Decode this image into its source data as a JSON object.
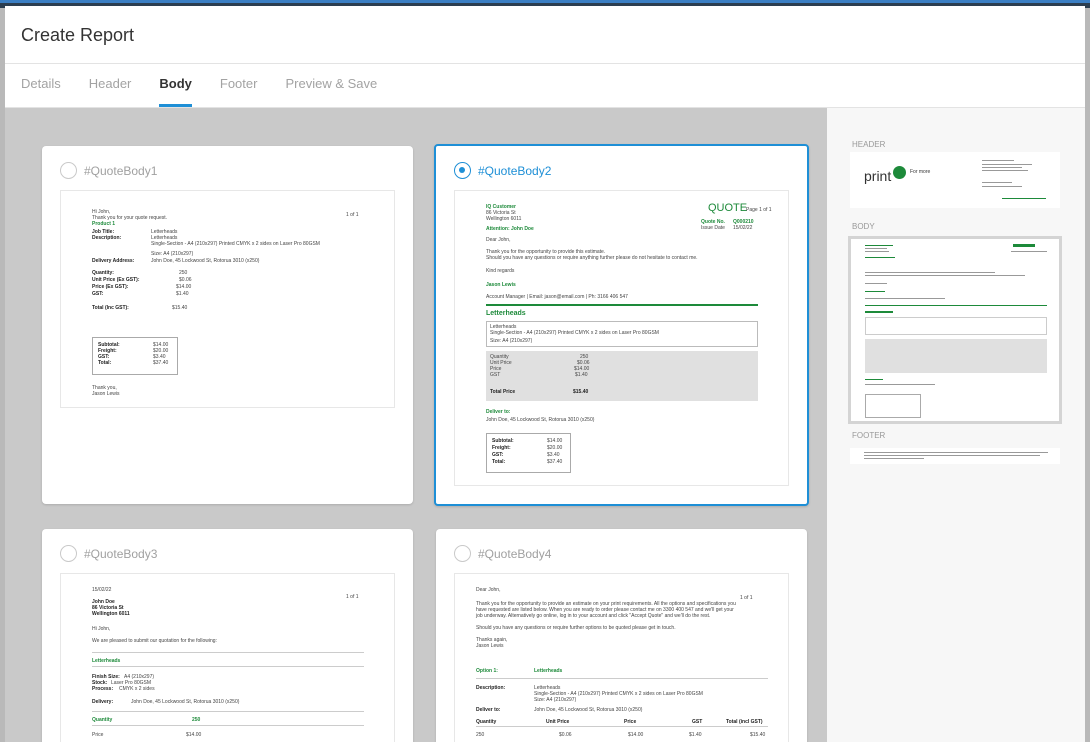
{
  "window": {
    "title": "Create Report"
  },
  "tabs": [
    {
      "label": "Details"
    },
    {
      "label": "Header"
    },
    {
      "label": "Body"
    },
    {
      "label": "Footer"
    },
    {
      "label": "Preview & Save"
    }
  ],
  "active_tab": "Body",
  "colors": {
    "accent": "#1e8fd6",
    "brand_green": "#1d8a3a"
  },
  "cards": [
    {
      "label": "#QuoteBody1",
      "selected": false,
      "preview": {
        "greeting": "Hi John,",
        "thanks": "Thank you for your quote request.",
        "page": "1 of 1",
        "product": "Product 1",
        "job_title_label": "Job Title:",
        "job_title": "Letterheads",
        "description_label": "Description:",
        "description_1": "Letterheads",
        "description_2": "Single-Section - A4 (210x297) Printed CMYK x 2 sides on Laser Pro 80GSM",
        "size": "Size: A4 (210x297)",
        "delivery_label": "Delivery Address:",
        "delivery": "John Doe, 45 Lockwood St, Rotorua 3010 (x250)",
        "quantity_label": "Quantity:",
        "quantity": "250",
        "unit_price_label": "Unit Price (Ex GST):",
        "unit_price": "$0.06",
        "price_label": "Price (Ex GST):",
        "price": "$14.00",
        "gst_label": "GST:",
        "gst": "$1.40",
        "total_label": "Total (Inc GST):",
        "total": "$15.40",
        "subtotal_label": "Subtotal:",
        "subtotal": "$14.00",
        "freight_label": "Freight:",
        "freight": "$20.00",
        "gst2": "$3.40",
        "grand_label": "Total:",
        "grand": "$37.40",
        "signoff": "Thank you,",
        "signer": "Jason Lewis"
      }
    },
    {
      "label": "#QuoteBody2",
      "selected": true,
      "preview": {
        "customer": "IQ Customer",
        "addr1": "86 Victoria St",
        "addr2": "Wellington 6011",
        "quote_title": "QUOTE",
        "page": "Page 1 of 1",
        "quote_no_label": "Quote No.",
        "quote_no": "Q000210",
        "issue_label": "Issue Date",
        "issue_date": "15/02/22",
        "attention": "Attention: John Doe",
        "dear": "Dear John,",
        "thanks": "Thank you for the opportunity to provide this estimate.",
        "question": "Should you have any questions or require anything further please do not hesitate to contact me.",
        "regards": "Kind regards",
        "signer": "Jason Lewis",
        "role": "Account Manager | Email: jason@email.com | Ph: 3166 406 547",
        "section": "Letterheads",
        "desc1": "Letterheads",
        "desc2": "Single-Section - A4 (210x297) Printed CMYK x 2 sides on Laser Pro 80GSM",
        "size": "Size: A4 (210x297)",
        "qty_label": "Quantity",
        "qty": "250",
        "unit_label": "Unit Price",
        "unit": "$0.06",
        "price_label": "Price",
        "price": "$14.00",
        "gst_label": "GST",
        "gst": "$1.40",
        "total_label": "Total Price",
        "total": "$15.40",
        "deliver_label": "Deliver to:",
        "deliver": "John Doe, 45 Lockwood St, Rotorua 3010 (x250)",
        "subtotal_label": "Subtotal:",
        "subtotal": "$14.00",
        "freight_label": "Freight:",
        "freight": "$20.00",
        "gst2_label": "GST:",
        "gst2": "$3.40",
        "grand_label": "Total:",
        "grand": "$37.40"
      }
    },
    {
      "label": "#QuoteBody3",
      "selected": false,
      "preview": {
        "date": "15/02/22",
        "page": "1 of 1",
        "name": "John Doe",
        "addr1": "86 Victoria St",
        "addr2": "Wellington 6011",
        "hi": "Hi John,",
        "intro": "We are pleased to submit our quotation for the following:",
        "section": "Letterheads",
        "finish_label": "Finish Size:",
        "finish": "A4 (210x297)",
        "stock_label": "Stock:",
        "stock": "Laser Pro 80GSM",
        "process_label": "Process:",
        "process": "CMYK x 2 sides",
        "delivery_label": "Delivery:",
        "delivery": "John Doe, 45 Lockwood St, Rotorua 3010 (x250)",
        "qty_label": "Quantity",
        "qty": "250",
        "price_label": "Price",
        "price": "$14.00"
      }
    },
    {
      "label": "#QuoteBody4",
      "selected": false,
      "preview": {
        "dear": "Dear John,",
        "page": "1 of 1",
        "p1a": "Thank you for the opportunity to provide an estimate on your print requirements. All the options and specifications you",
        "p1b": "have requested are listed below. When you are ready to order please contact me on 3300 400 547 and we'll get your",
        "p1c": "job underway. Alternatively go online, log in to your account and click \"Accept Quote\" and we'll do the rest.",
        "p2": "Should you have any questions or require further options to be quoted please get in touch.",
        "thanks": "Thanks again,",
        "signer": "Jason Lewis",
        "option": "Option 1:",
        "option_name": "Letterheads",
        "desc_label": "Description:",
        "desc1": "Letterheads",
        "desc2": "Single-Section - A4 (210x297) Printed CMYK x 2 sides on Laser Pro 80GSM",
        "size": "Size: A4 (210x297)",
        "deliver_label": "Deliver to:",
        "deliver": "John Doe, 45 Lockwood St, Rotorua 3010 (x250)",
        "h_qty": "Quantity",
        "h_unit": "Unit Price",
        "h_price": "Price",
        "h_gst": "GST",
        "h_total": "Total (incl GST)",
        "r_qty": "250",
        "r_unit": "$0.06",
        "r_price": "$14.00",
        "r_gst": "$1.40",
        "r_total": "$15.40"
      }
    }
  ],
  "side_panel": {
    "header_label": "HEADER",
    "body_label": "BODY",
    "footer_label": "FOOTER",
    "logo_text": "print",
    "logo_sub": "For more"
  }
}
